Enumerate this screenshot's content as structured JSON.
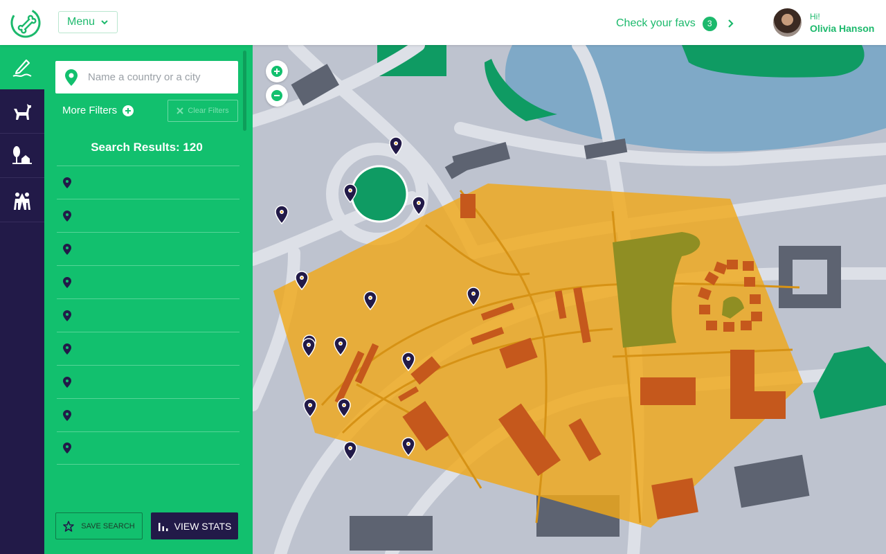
{
  "header": {
    "menu_label": "Menu",
    "favs_label": "Check your favs",
    "favs_count": "3",
    "greeting": "Hi!",
    "user_name": "Olivia Hanson"
  },
  "nav": {
    "items": [
      {
        "icon": "pencil-icon",
        "active": true
      },
      {
        "icon": "dog-icon",
        "active": false
      },
      {
        "icon": "tree-house-icon",
        "active": false
      },
      {
        "icon": "people-icon",
        "active": false
      }
    ]
  },
  "sidebar": {
    "search_placeholder": "Name a country or a city",
    "more_filters": "More Filters",
    "clear_filters": "Clear Filters",
    "results_title": "Search Results: 120",
    "result_count_rows": 9,
    "save_search": "SAVE SEARCH",
    "view_stats": "VIEW STATS"
  },
  "colors": {
    "brand_green": "#12c06e",
    "dark_navy": "#221a48",
    "area_overlay": "#f0a81a",
    "marker": "#221a48"
  },
  "map": {
    "zoom_in_icon": "plus-icon",
    "zoom_out_icon": "minus-icon",
    "marker_icon": "map-pin-icon"
  }
}
